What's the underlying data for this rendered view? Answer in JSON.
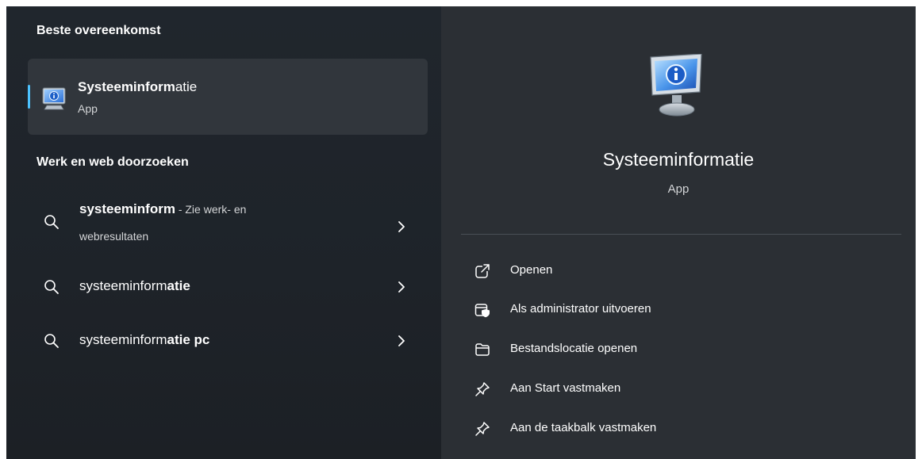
{
  "left": {
    "best_match_heading": "Beste overeenkomst",
    "best_match": {
      "title_highlight": "Systeeminform",
      "title_rest": "atie",
      "subtitle": "App",
      "icon": "system-information-icon"
    },
    "web_heading": "Werk en web doorzoeken",
    "results": [
      {
        "query": "systeeminform",
        "suffix": " - Zie werk- en",
        "line2": "webresultaten",
        "icon": "search-icon"
      },
      {
        "query_normal": "systeeminform",
        "query_bold": "atie",
        "icon": "search-icon"
      },
      {
        "query_normal": "systeeminform",
        "query_bold": "atie pc",
        "icon": "search-icon"
      }
    ]
  },
  "right": {
    "title": "Systeeminformatie",
    "subtitle": "App",
    "icon": "system-information-icon",
    "actions": [
      {
        "label": "Openen",
        "icon": "open-external-icon"
      },
      {
        "label": "Als administrator uitvoeren",
        "icon": "run-as-admin-icon"
      },
      {
        "label": "Bestandslocatie openen",
        "icon": "folder-icon"
      },
      {
        "label": "Aan Start vastmaken",
        "icon": "pin-icon"
      },
      {
        "label": "Aan de taakbalk vastmaken",
        "icon": "pin-icon"
      }
    ]
  },
  "colors": {
    "accent": "#4cc2ff",
    "left_bg": "#1f2328",
    "right_bg": "#2b2f34",
    "selected_bg": "#31363c"
  }
}
